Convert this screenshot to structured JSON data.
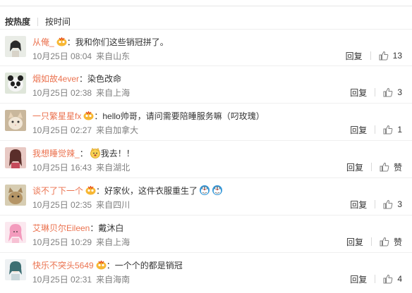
{
  "sort": {
    "hot": "按热度",
    "time": "按时间"
  },
  "comments": [
    {
      "user": "从俺_",
      "badge": true,
      "sep": "：",
      "text": "我和你们这些销冠拼了。",
      "emoji": [],
      "time": "10月25日 08:04",
      "location": "来自山东",
      "reply": "回复",
      "likes": "13"
    },
    {
      "user": "烟如故4ever",
      "badge": false,
      "sep": "：",
      "text": "染色改命",
      "emoji": [],
      "time": "10月25日 02:38",
      "location": "来自上海",
      "reply": "回复",
      "likes": "3"
    },
    {
      "user": "一只繁星星fx",
      "badge": true,
      "sep": "：",
      "text": "hello帅哥，请问需要陪睡服务嘛（叼玫瑰）",
      "emoji": [],
      "time": "10月25日 02:27",
      "location": "来自加拿大",
      "reply": "回复",
      "likes": "1"
    },
    {
      "user": "我想睡觉辣_",
      "badge": false,
      "sep": "：",
      "text": "我去！！",
      "emoji": [
        "cat-emoji"
      ],
      "time": "10月25日 16:43",
      "location": "来自湖北",
      "reply": "回复",
      "likes": "赞"
    },
    {
      "user": "谈不了下一个",
      "badge": true,
      "sep": "：",
      "text": "好家伙，这件衣服重生了",
      "emoji": [
        "doraemon-emoji",
        "doraemon-emoji"
      ],
      "time": "10月25日 02:35",
      "location": "来自四川",
      "reply": "回复",
      "likes": "3"
    },
    {
      "user": "艾琳贝尔Eileen",
      "badge": false,
      "sep": "：",
      "text": "戴沐白",
      "emoji": [],
      "time": "10月25日 10:29",
      "location": "来自上海",
      "reply": "回复",
      "likes": "赞"
    },
    {
      "user": "快乐不突头5649",
      "badge": true,
      "sep": "：",
      "text": "一个个的都是销冠",
      "emoji": [],
      "time": "10月25日 02:31",
      "location": "来自海南",
      "reply": "回复",
      "likes": "4"
    }
  ],
  "colors": {
    "username": "#eb7350",
    "meta": "#808080",
    "text": "#333333",
    "divider": "#efefef"
  }
}
